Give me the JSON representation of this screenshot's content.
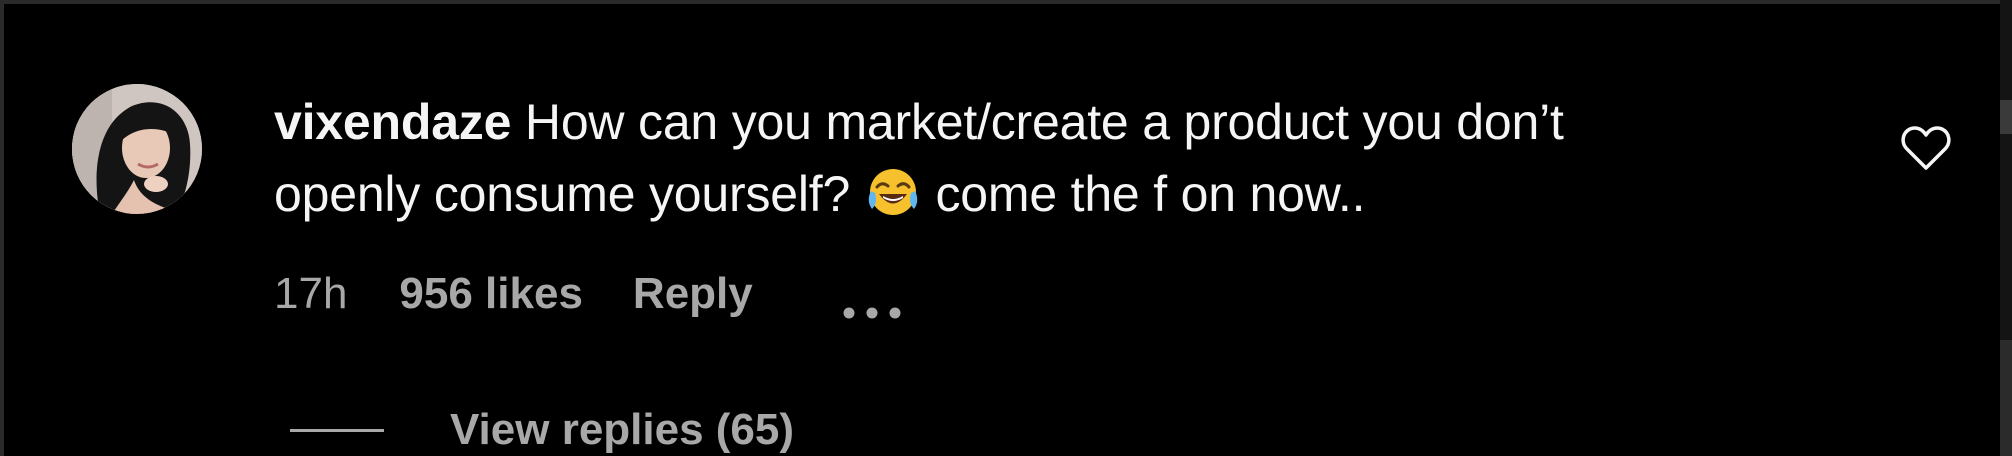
{
  "comment": {
    "username": "vixendaze",
    "text_line1": " How can you market/create a product you don’t",
    "text_line2_before_emoji": "openly consume yourself? ",
    "emoji": "face-with-tears-of-joy",
    "text_line2_after_emoji": " come the f on now.."
  },
  "meta": {
    "time": "17h",
    "likes": "956 likes",
    "reply": "Reply",
    "more_icon": "ellipsis-icon"
  },
  "replies": {
    "label": "View replies (65)"
  },
  "icons": {
    "like": "heart-outline-icon"
  },
  "colors": {
    "background": "#000000",
    "primary_text": "#f5f5f5",
    "secondary_text": "#a8a8a8"
  }
}
